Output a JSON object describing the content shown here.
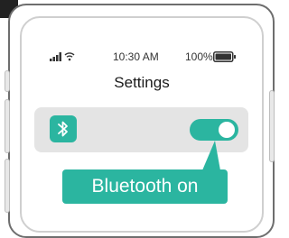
{
  "status_bar": {
    "time": "10:30 AM",
    "battery": "100%",
    "icons": [
      "signal-icon",
      "wifi-icon",
      "battery-icon"
    ]
  },
  "screen": {
    "title": "Settings"
  },
  "bluetooth_row": {
    "icon": "bluetooth-icon",
    "toggle_state": "on"
  },
  "callout": {
    "label": "Bluetooth on"
  },
  "colors": {
    "accent": "#2bb5a0",
    "row_background": "#e4e4e4",
    "frame": "#6e6e6e"
  }
}
